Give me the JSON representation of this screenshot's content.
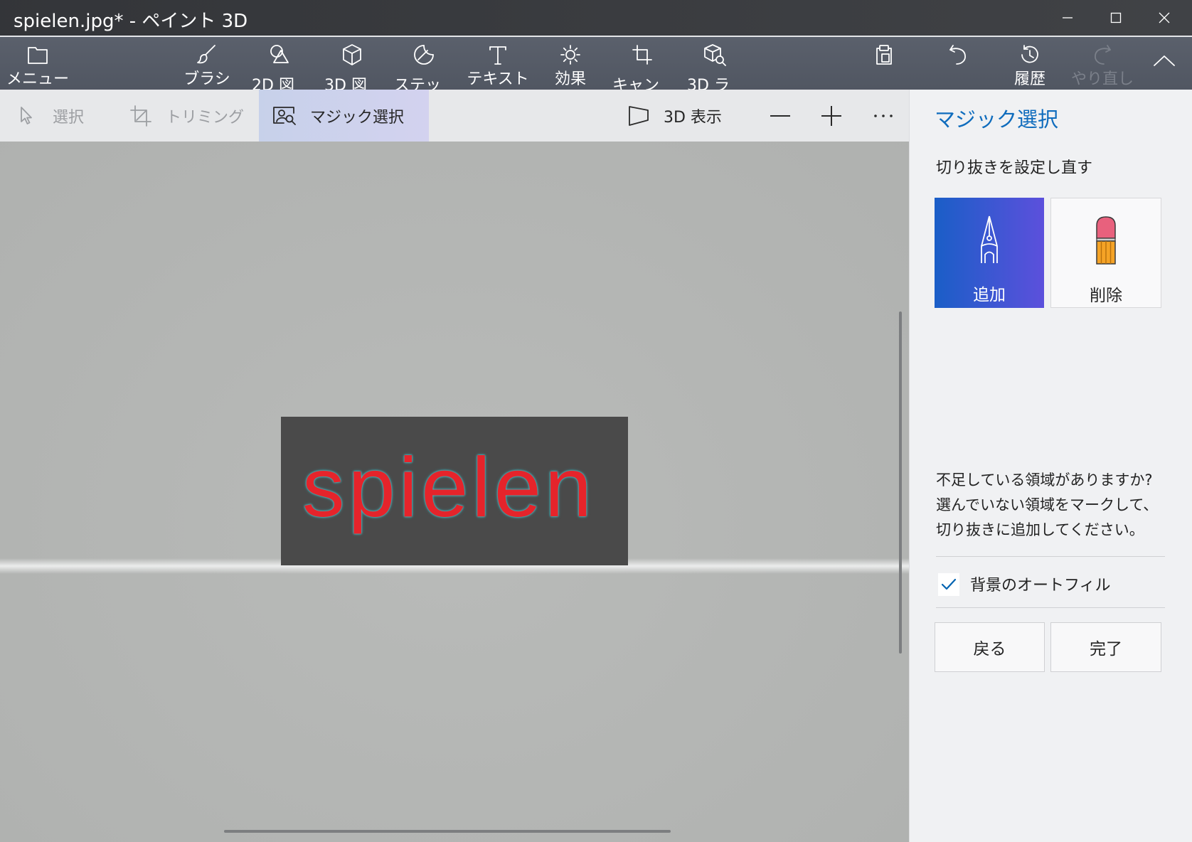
{
  "window": {
    "title": "spielen.jpg* - ペイント 3D",
    "minimize_icon": "minimize-icon",
    "maximize_icon": "maximize-icon",
    "close_icon": "close-icon"
  },
  "ribbon": {
    "menu": {
      "label": "メニュー",
      "icon": "folder-icon"
    },
    "tools": [
      {
        "label": "ブラシ",
        "icon": "brush-icon"
      },
      {
        "label": "2D 図",
        "icon": "2d-shapes-icon"
      },
      {
        "label": "3D 図",
        "icon": "3d-shapes-icon"
      },
      {
        "label": "ステッ",
        "icon": "stickers-icon"
      },
      {
        "label": "テキスト",
        "icon": "text-icon"
      },
      {
        "label": "効果",
        "icon": "effects-icon"
      },
      {
        "label": "キャン",
        "icon": "canvas-icon"
      },
      {
        "label": "3D ラ",
        "icon": "3d-library-icon"
      }
    ],
    "actions": [
      {
        "icon": "paste-icon"
      },
      {
        "icon": "undo-icon"
      },
      {
        "label": "履歴",
        "icon": "history-icon"
      },
      {
        "label": "やり直し",
        "icon": "redo-icon",
        "disabled": true
      }
    ],
    "collapse_icon": "chevron-up-icon"
  },
  "toolbar": {
    "items": [
      {
        "label": "選択",
        "icon": "select-cursor-icon",
        "disabled": true
      },
      {
        "label": "トリミング",
        "icon": "crop-icon",
        "disabled": true
      },
      {
        "label": "マジック選択",
        "icon": "magic-select-icon",
        "selected": true
      }
    ],
    "view_3d": {
      "label": "3D 表示",
      "icon": "3d-view-icon"
    },
    "zoom_out_icon": "minus-icon",
    "zoom_in_icon": "plus-icon",
    "more_icon": "more-icon"
  },
  "canvas": {
    "image_text": "spielen",
    "image_text_color": "#e5242b",
    "image_background": "#4a4a4a"
  },
  "panel": {
    "title": "マジック選択",
    "refine_heading": "切り抜きを設定し直す",
    "modes": [
      {
        "label": "追加",
        "icon": "pen-add-icon",
        "selected": true
      },
      {
        "label": "削除",
        "icon": "eraser-icon",
        "selected": false
      }
    ],
    "help_lines": [
      "不足している領域がありますか?",
      "選んでいない領域をマークして、",
      "切り抜きに追加してください。"
    ],
    "autofill": {
      "label": "背景のオートフィル",
      "checked": true
    },
    "buttons": {
      "back": "戻る",
      "done": "完了"
    }
  },
  "colors": {
    "accent": "#0063b1",
    "panel_title": "#0f6cbd",
    "titlebar": "#36383c",
    "ribbon": "#555b67",
    "canvas": "#b5b7b5",
    "panel": "#f0f1f3"
  }
}
